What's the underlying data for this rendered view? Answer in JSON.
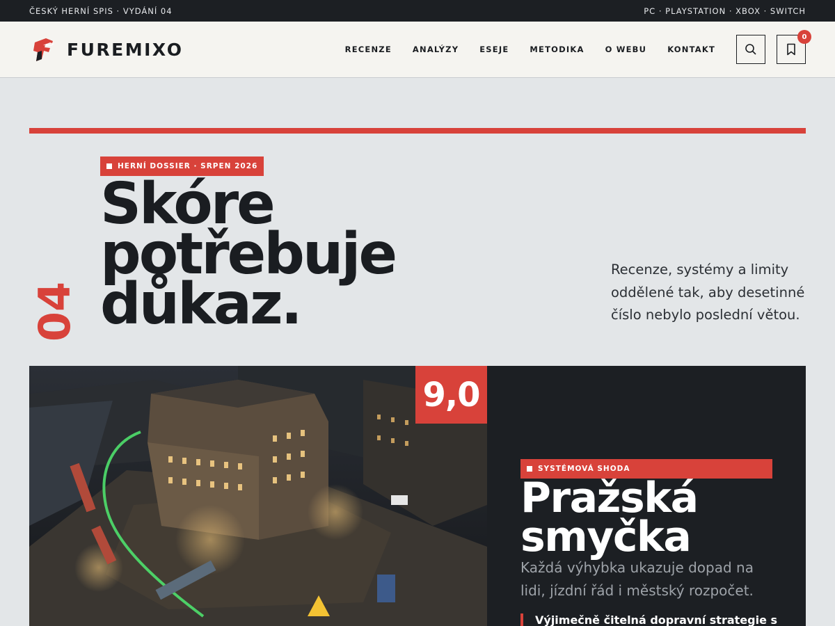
{
  "topbar": {
    "left": "ČESKÝ HERNÍ SPIS · VYDÁNÍ 04",
    "right": "PC · PLAYSTATION · XBOX · SWITCH"
  },
  "header": {
    "logo_text": "FUREMIXO",
    "nav": [
      "RECENZE",
      "ANALÝZY",
      "ESEJE",
      "METODIKA",
      "O WEBU",
      "KONTAKT"
    ],
    "bookmark_count": "0"
  },
  "hero": {
    "tag": "HERNÍ DOSSIER · SRPEN 2026",
    "issue_number": "04",
    "title_lines": [
      "Skóre",
      "potřebuje",
      "důkaz."
    ],
    "lead": "Recenze, systémy a limity oddělené tak, aby desetinné číslo nebylo poslední větou."
  },
  "feature": {
    "score": "9,0",
    "tag": "SYSTÉMOVÁ SHODA",
    "title_lines": [
      "Pražská",
      "smyčka"
    ],
    "description": "Každá výhybka ukazuje dopad na lidi, jízdní řád i městský rozpočet.",
    "quote": "Výjimečně čitelná dopravní strategie s"
  },
  "colors": {
    "accent": "#d8423a",
    "dark": "#1c1f23",
    "page_bg": "#e3e6e8",
    "header_bg": "#f5f4f0"
  },
  "icons": [
    "furemixo-logo-icon",
    "search-icon",
    "bookmark-icon"
  ]
}
